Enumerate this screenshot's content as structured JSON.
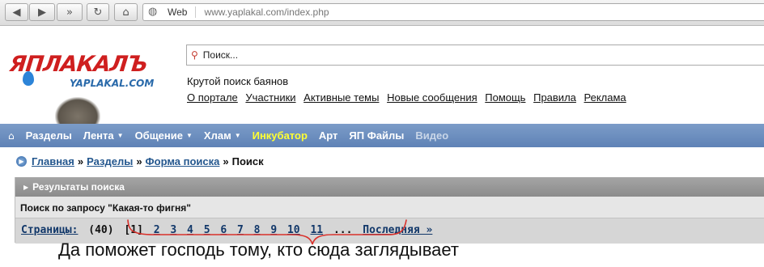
{
  "browser": {
    "security_label": "Web",
    "url": "www.yaplakal.com/index.php"
  },
  "site": {
    "logo_text": "ЯПЛАКАЛЪ",
    "logo_sub": "YAPLAKAL.COM",
    "search": {
      "placeholder": "Поиск..."
    },
    "tagline": "Крутой поиск баянов",
    "top_links": [
      "О портале",
      "Участники",
      "Активные темы",
      "Новые сообщения",
      "Помощь",
      "Правила",
      "Реклама"
    ]
  },
  "nav": {
    "items": [
      "Разделы",
      "Лента",
      "Общение",
      "Хлам",
      "Инкубатор",
      "Арт",
      "ЯП Файлы",
      "Видео"
    ],
    "colors": {
      "bar": "#5f82b6",
      "incubator": "#ffff33"
    }
  },
  "breadcrumb": {
    "items": [
      "Главная",
      "Разделы",
      "Форма поиска"
    ],
    "separator": "»",
    "current": "Поиск"
  },
  "results": {
    "header": "Результаты поиска",
    "query_line": "Поиск по запросу \"Какая-то фигня\"",
    "pages_label": "Страницы:",
    "pages_count": "(40)",
    "current_page": "[1]",
    "page_links": [
      "2",
      "3",
      "4",
      "5",
      "6",
      "7",
      "8",
      "9",
      "10",
      "11"
    ],
    "ellipsis": "...",
    "last_label": "Последняя »"
  },
  "annotation": {
    "caption": "Да поможет господь тому, кто сюда заглядывает",
    "color": "#d9302a"
  }
}
